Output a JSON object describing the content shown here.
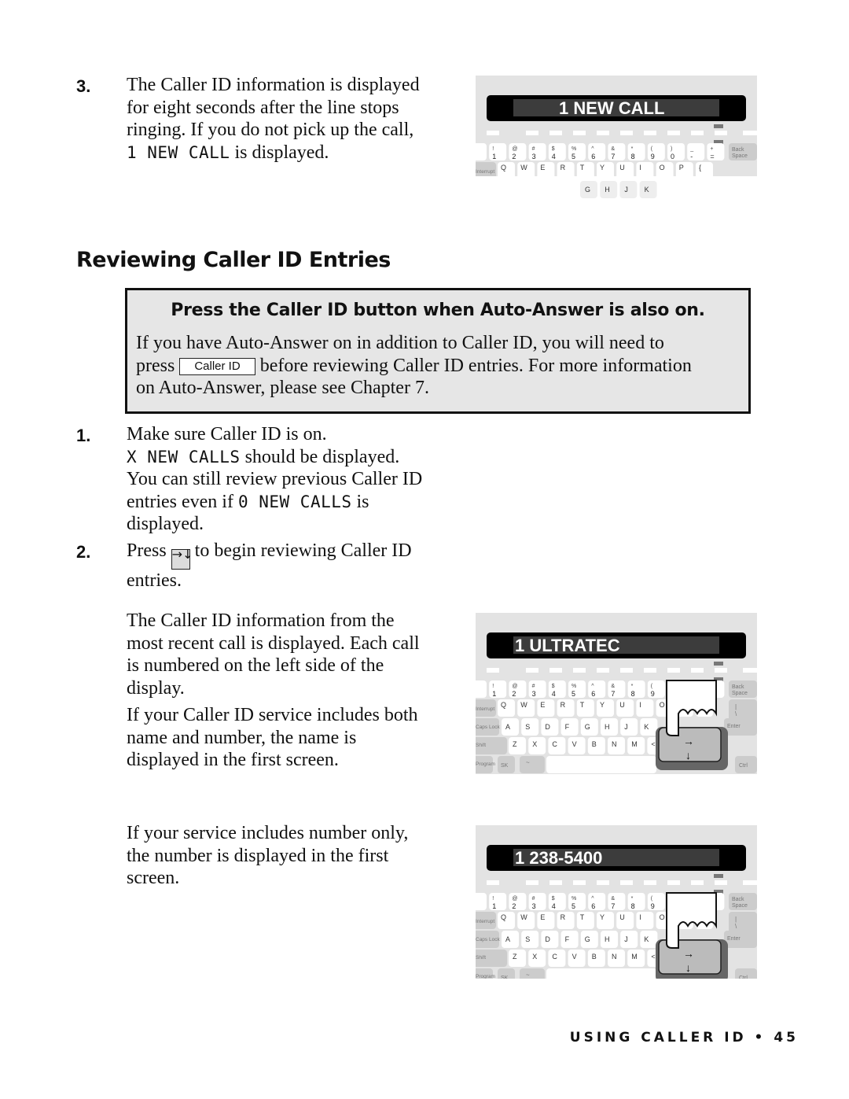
{
  "step3": {
    "number": "3.",
    "lines": [
      "The Caller ID information is displayed",
      "for eight seconds after the line stops",
      "ringing. If you do not pick up the call,"
    ],
    "lcd": "1 NEW CALL",
    "tail": " is displayed."
  },
  "section_title": "Reviewing Caller ID Entries",
  "note": {
    "title": "Press the Caller ID button when Auto-Answer is also on.",
    "line1": "If you have Auto-Answer on in addition to Caller ID, you will need to",
    "press": "press",
    "button": "Caller ID",
    "line2_rest": "before reviewing Caller ID entries. For more information",
    "line3": "on Auto-Answer, please see Chapter 7."
  },
  "step1": {
    "number": "1.",
    "line1": "Make sure Caller ID is on.",
    "lcd1": "X NEW CALLS",
    "line2_rest": " should be displayed.",
    "line3": "You can still review previous Caller ID",
    "line4a": "entries even if ",
    "lcd2": "0 NEW CALLS",
    "line4b": " is",
    "line5": "displayed."
  },
  "step2": {
    "number": "2.",
    "press": "Press",
    "arrow_key": "→↓",
    "rest": "to begin reviewing Caller ID",
    "line2": "entries."
  },
  "para1": [
    "The Caller ID information from the",
    "most recent call is displayed. Each call",
    "is numbered on the left side of the",
    "display."
  ],
  "para2": [
    "If your Caller ID service includes both",
    "name and number, the name is",
    "displayed in the first screen."
  ],
  "para3": [
    "If your service includes number only,",
    "the number is displayed in the first",
    "screen."
  ],
  "displays": {
    "first": "1 NEW CALL",
    "second": "1 ULTRATEC",
    "third": "1 238-5400"
  },
  "keyboard": {
    "number_row_top": [
      "~",
      "!",
      "@",
      "#",
      "$",
      "%",
      "^",
      "&",
      "*",
      "(",
      ")",
      "_",
      "+"
    ],
    "number_row_bottom": [
      "`",
      "1",
      "2",
      "3",
      "4",
      "5",
      "6",
      "7",
      "8",
      "9",
      "0",
      "-",
      "="
    ],
    "backspace": [
      "Back",
      "Space"
    ],
    "qwerty": [
      "Q",
      "W",
      "E",
      "R",
      "T",
      "Y",
      "U",
      "I",
      "O",
      "P",
      "{"
    ],
    "interrupt": "Interrupt",
    "asdf": [
      "A",
      "S",
      "D",
      "F",
      "G",
      "H",
      "J",
      "K"
    ],
    "caps": "Caps Lock",
    "enter": "Enter",
    "zxcv": [
      "Z",
      "X",
      "C",
      "V",
      "B",
      "N",
      "M",
      "<",
      "?"
    ],
    "shift": "Shift",
    "program": "Program",
    "sk": "SK",
    "ctrl": "Ctrl",
    "pipe": [
      "|",
      "\\"
    ],
    "arrow_right": "→",
    "arrow_down": "↓"
  },
  "footer": "USING CALLER ID • 45"
}
